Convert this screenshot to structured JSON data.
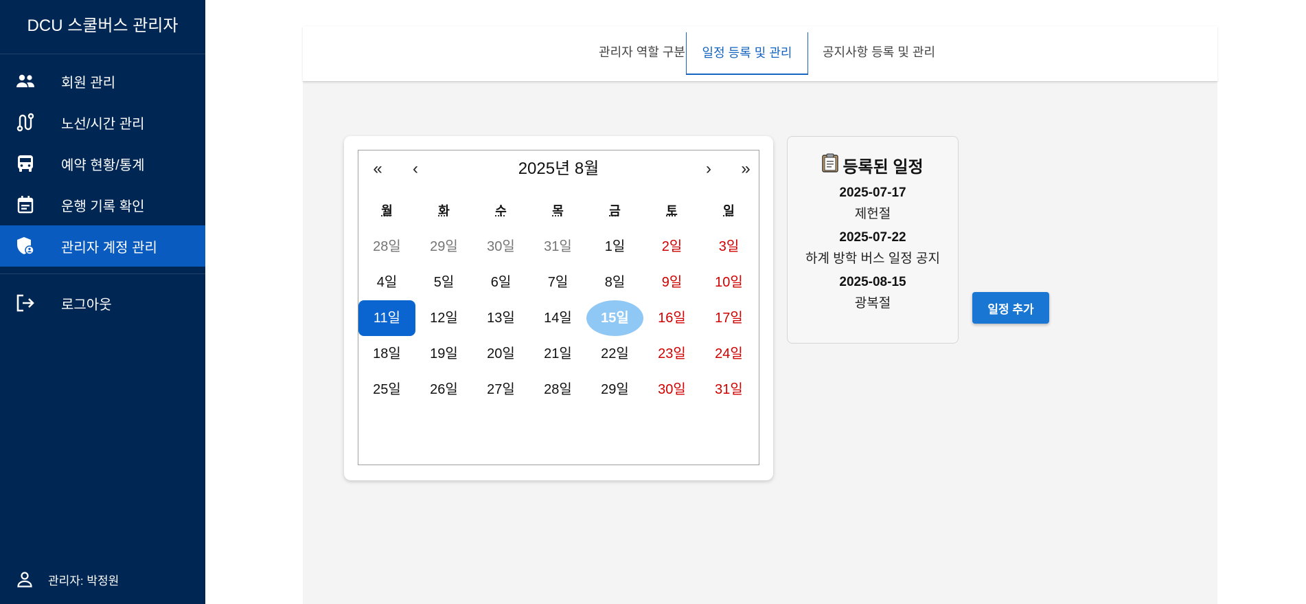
{
  "sidebar": {
    "brand": "DCU 스쿨버스 관리자",
    "items": [
      {
        "label": "회원 관리",
        "icon": "people-icon"
      },
      {
        "label": "노선/시간 관리",
        "icon": "route-icon"
      },
      {
        "label": "예약 현황/통계",
        "icon": "bus-icon"
      },
      {
        "label": "운행 기록 확인",
        "icon": "calendar-icon"
      },
      {
        "label": "관리자 계정 관리",
        "icon": "admin-shield-icon",
        "active": true
      }
    ],
    "logout": {
      "label": "로그아웃",
      "icon": "logout-icon"
    },
    "admin_user": {
      "label": "관리자: 박정원",
      "icon": "person-icon"
    }
  },
  "tabs": [
    {
      "label": "관리자 역할 구분"
    },
    {
      "label": "일정 등록 및 관리",
      "active": true
    },
    {
      "label": "공지사항 등록 및 관리"
    }
  ],
  "calendar": {
    "title": "2025년 8월",
    "nav": {
      "prev_year": "«",
      "prev_month": "‹",
      "next_month": "›",
      "next_year": "»"
    },
    "weekdays": [
      "월",
      "화",
      "수",
      "목",
      "금",
      "토",
      "일"
    ],
    "weeks": [
      [
        "28일",
        "29일",
        "30일",
        "31일",
        "1일",
        "2일",
        "3일"
      ],
      [
        "4일",
        "5일",
        "6일",
        "7일",
        "8일",
        "9일",
        "10일"
      ],
      [
        "11일",
        "12일",
        "13일",
        "14일",
        "15일",
        "16일",
        "17일"
      ],
      [
        "18일",
        "19일",
        "20일",
        "21일",
        "22일",
        "23일",
        "24일"
      ],
      [
        "25일",
        "26일",
        "27일",
        "28일",
        "29일",
        "30일",
        "31일"
      ]
    ],
    "selected_day": "11일",
    "today": "15일"
  },
  "schedule": {
    "title": "등록된 일정",
    "title_icon": "clipboard-icon",
    "items": [
      {
        "date": "2025-07-17",
        "name": "제헌절"
      },
      {
        "date": "2025-07-22",
        "name": "하계 방학 버스 일정 공지"
      },
      {
        "date": "2025-08-15",
        "name": "광복절"
      }
    ]
  },
  "add_button": {
    "label": "일정 추가"
  },
  "colors": {
    "sidebar_bg": "#002654",
    "sidebar_active": "#0a5bbf",
    "accent": "#1976d2",
    "weekend": "#d10000",
    "today_bg": "#90c8f5"
  }
}
